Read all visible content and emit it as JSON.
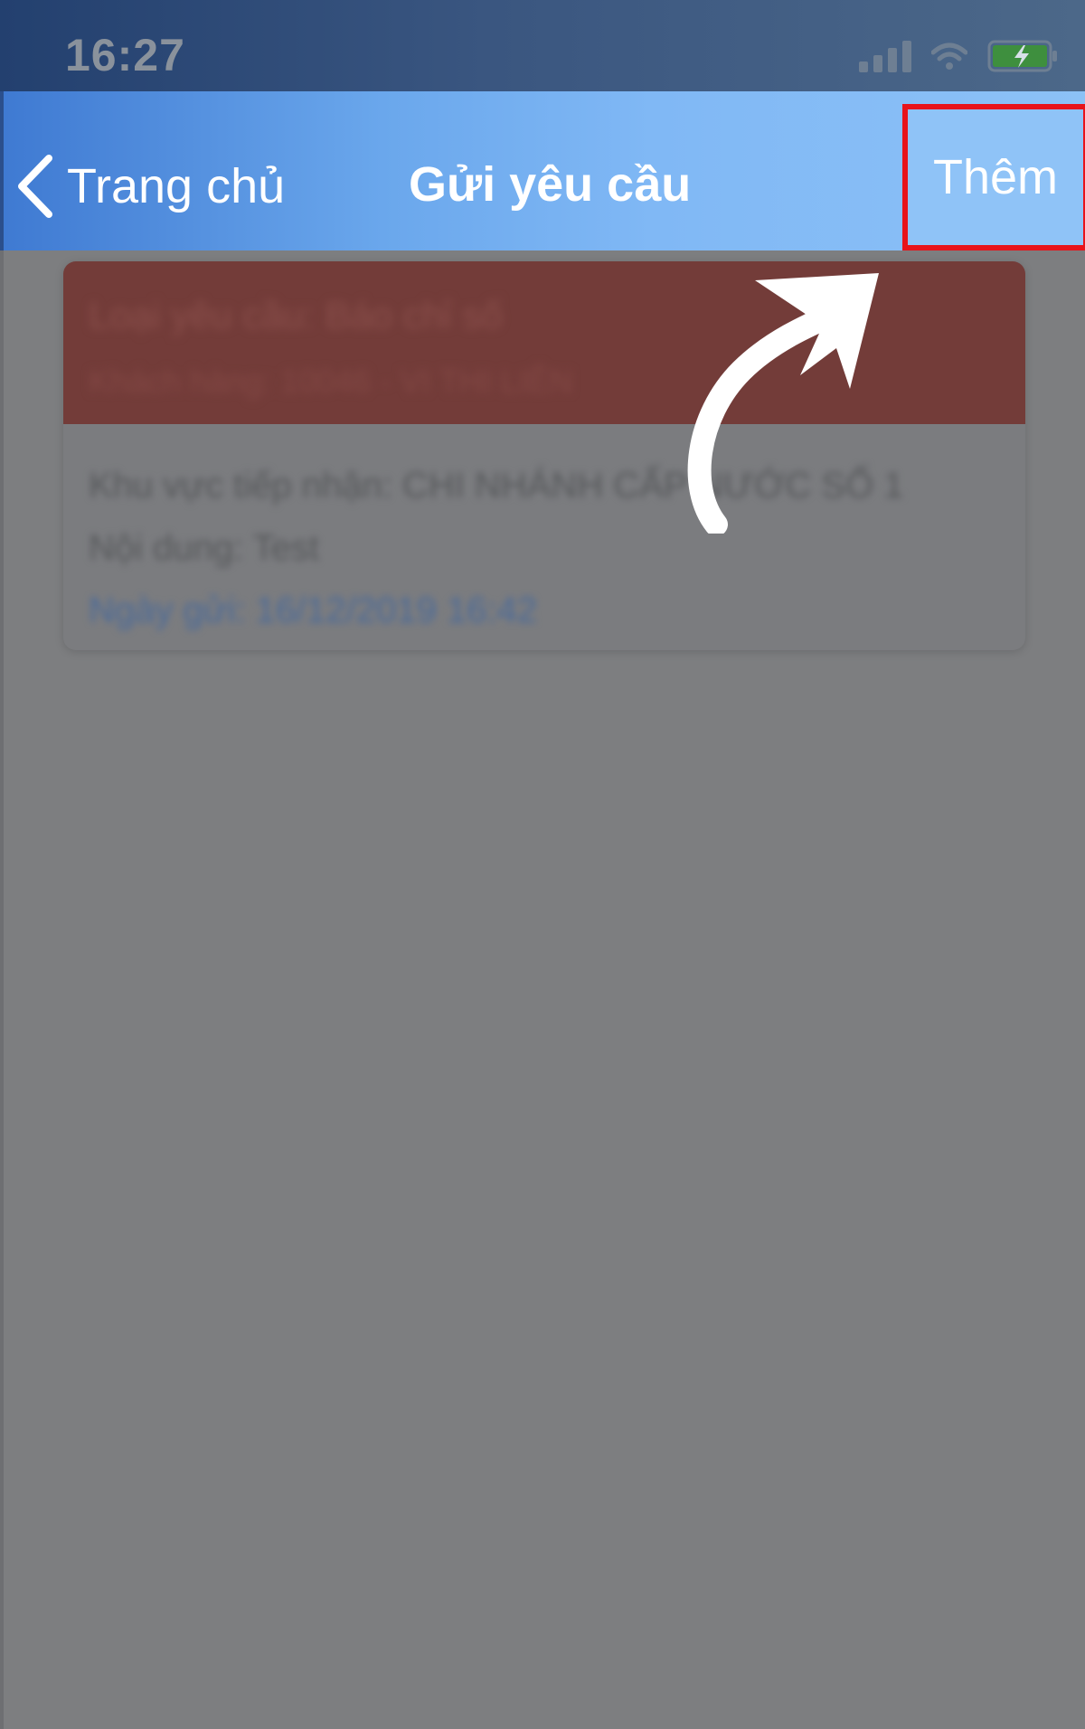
{
  "status_bar": {
    "time": "16:27"
  },
  "nav_bar": {
    "back_label": "Trang chủ",
    "title": "Gửi yêu cầu",
    "add_label": "Thêm"
  },
  "request_card": {
    "type_line": "Loại yêu cầu: Báo chỉ số",
    "customer_line": "Khách hàng: 10046 - VI THI LIÊN",
    "area_line": "Khu vực tiếp nhận: CHI NHÁNH CẤP NƯỚC SỐ 1",
    "content_line": "Nội dung: Test",
    "date_line": "Ngày gửi: 16/12/2019 16:42"
  },
  "colors": {
    "highlight_border": "#e8131a",
    "card_header": "#733c39",
    "overlay": "#7d7e80"
  },
  "icons": [
    "back-chevron-icon",
    "signal-icon",
    "wifi-icon",
    "battery-icon",
    "curved-arrow-icon"
  ]
}
